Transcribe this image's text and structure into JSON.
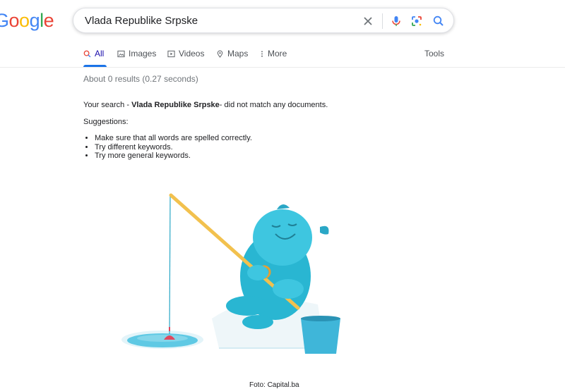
{
  "logo": {
    "letters": [
      "G",
      "o",
      "o",
      "g",
      "l",
      "e"
    ],
    "colors": [
      "#4285F4",
      "#EA4335",
      "#FBBC05",
      "#4285F4",
      "#34A853",
      "#EA4335"
    ]
  },
  "search": {
    "query": "Vlada Republike Srpske",
    "clear_icon": "close-icon",
    "voice_icon": "mic-icon",
    "lens_icon": "lens-icon",
    "search_icon": "search-icon"
  },
  "tabs": [
    {
      "label": "All",
      "icon": "search-icon",
      "active": true
    },
    {
      "label": "Images",
      "icon": "image-icon"
    },
    {
      "label": "Videos",
      "icon": "play-icon"
    },
    {
      "label": "Maps",
      "icon": "pin-icon"
    },
    {
      "label": "More",
      "icon": "more-icon"
    }
  ],
  "tools_label": "Tools",
  "results": {
    "stats": "About 0 results (0.27 seconds)",
    "message_prefix": "Your search - ",
    "message_query": "Vlada Republike Srpske",
    "message_suffix": "- did not match any documents.",
    "suggestions_title": "Suggestions:",
    "suggestions": [
      "Make sure that all words are spelled correctly.",
      "Try different keywords.",
      "Try more general keywords."
    ]
  },
  "caption": "Foto: Capital.ba",
  "colors": {
    "accent": "#1a73e8",
    "creature": "#29b6d2",
    "rod": "#f2c14e",
    "bucket": "#3fb6d9"
  }
}
